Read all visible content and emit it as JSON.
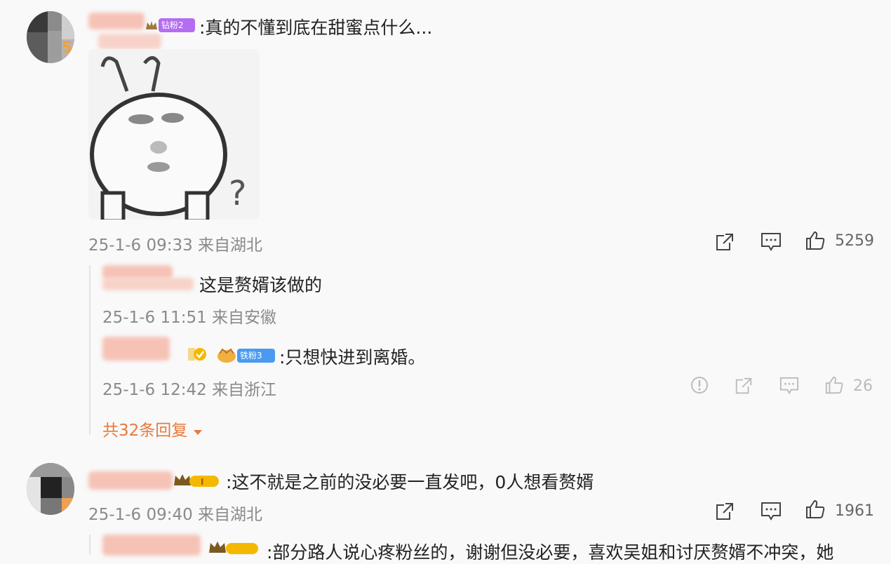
{
  "comments": [
    {
      "badge": "钻粉2",
      "level_num": "5",
      "text": ":真的不懂到底在甜蜜点什么...",
      "meta": "25-1-6 09:33 来自湖北",
      "likes": "5259",
      "replies": [
        {
          "text": "这是赘婿该做的",
          "meta": "25-1-6 11:51 来自安徽"
        },
        {
          "badge": "铁粉3",
          "text": ":只想快进到离婚。",
          "meta": "25-1-6 12:42 来自浙江",
          "likes": "26"
        }
      ],
      "more_replies": "共32条回复"
    },
    {
      "text": ":这不就是之前的没必要一直发吧，0人想看赘婿",
      "meta": "25-1-6 09:40 来自湖北",
      "likes": "1961",
      "replies": [
        {
          "text": ":部分路人说心疼粉丝的，谢谢但没必要，喜欢吴姐和讨厌赘婿不冲突，她"
        }
      ]
    }
  ],
  "colors": {
    "accent": "#e8793a",
    "badge_purple": "#b46df0",
    "badge_blue": "#4a9bf0",
    "crown": "#f5b800"
  },
  "icons": [
    "share-icon",
    "comment-icon",
    "like-icon",
    "report-icon",
    "caret-down-icon",
    "verified-icon",
    "crown-icon"
  ]
}
